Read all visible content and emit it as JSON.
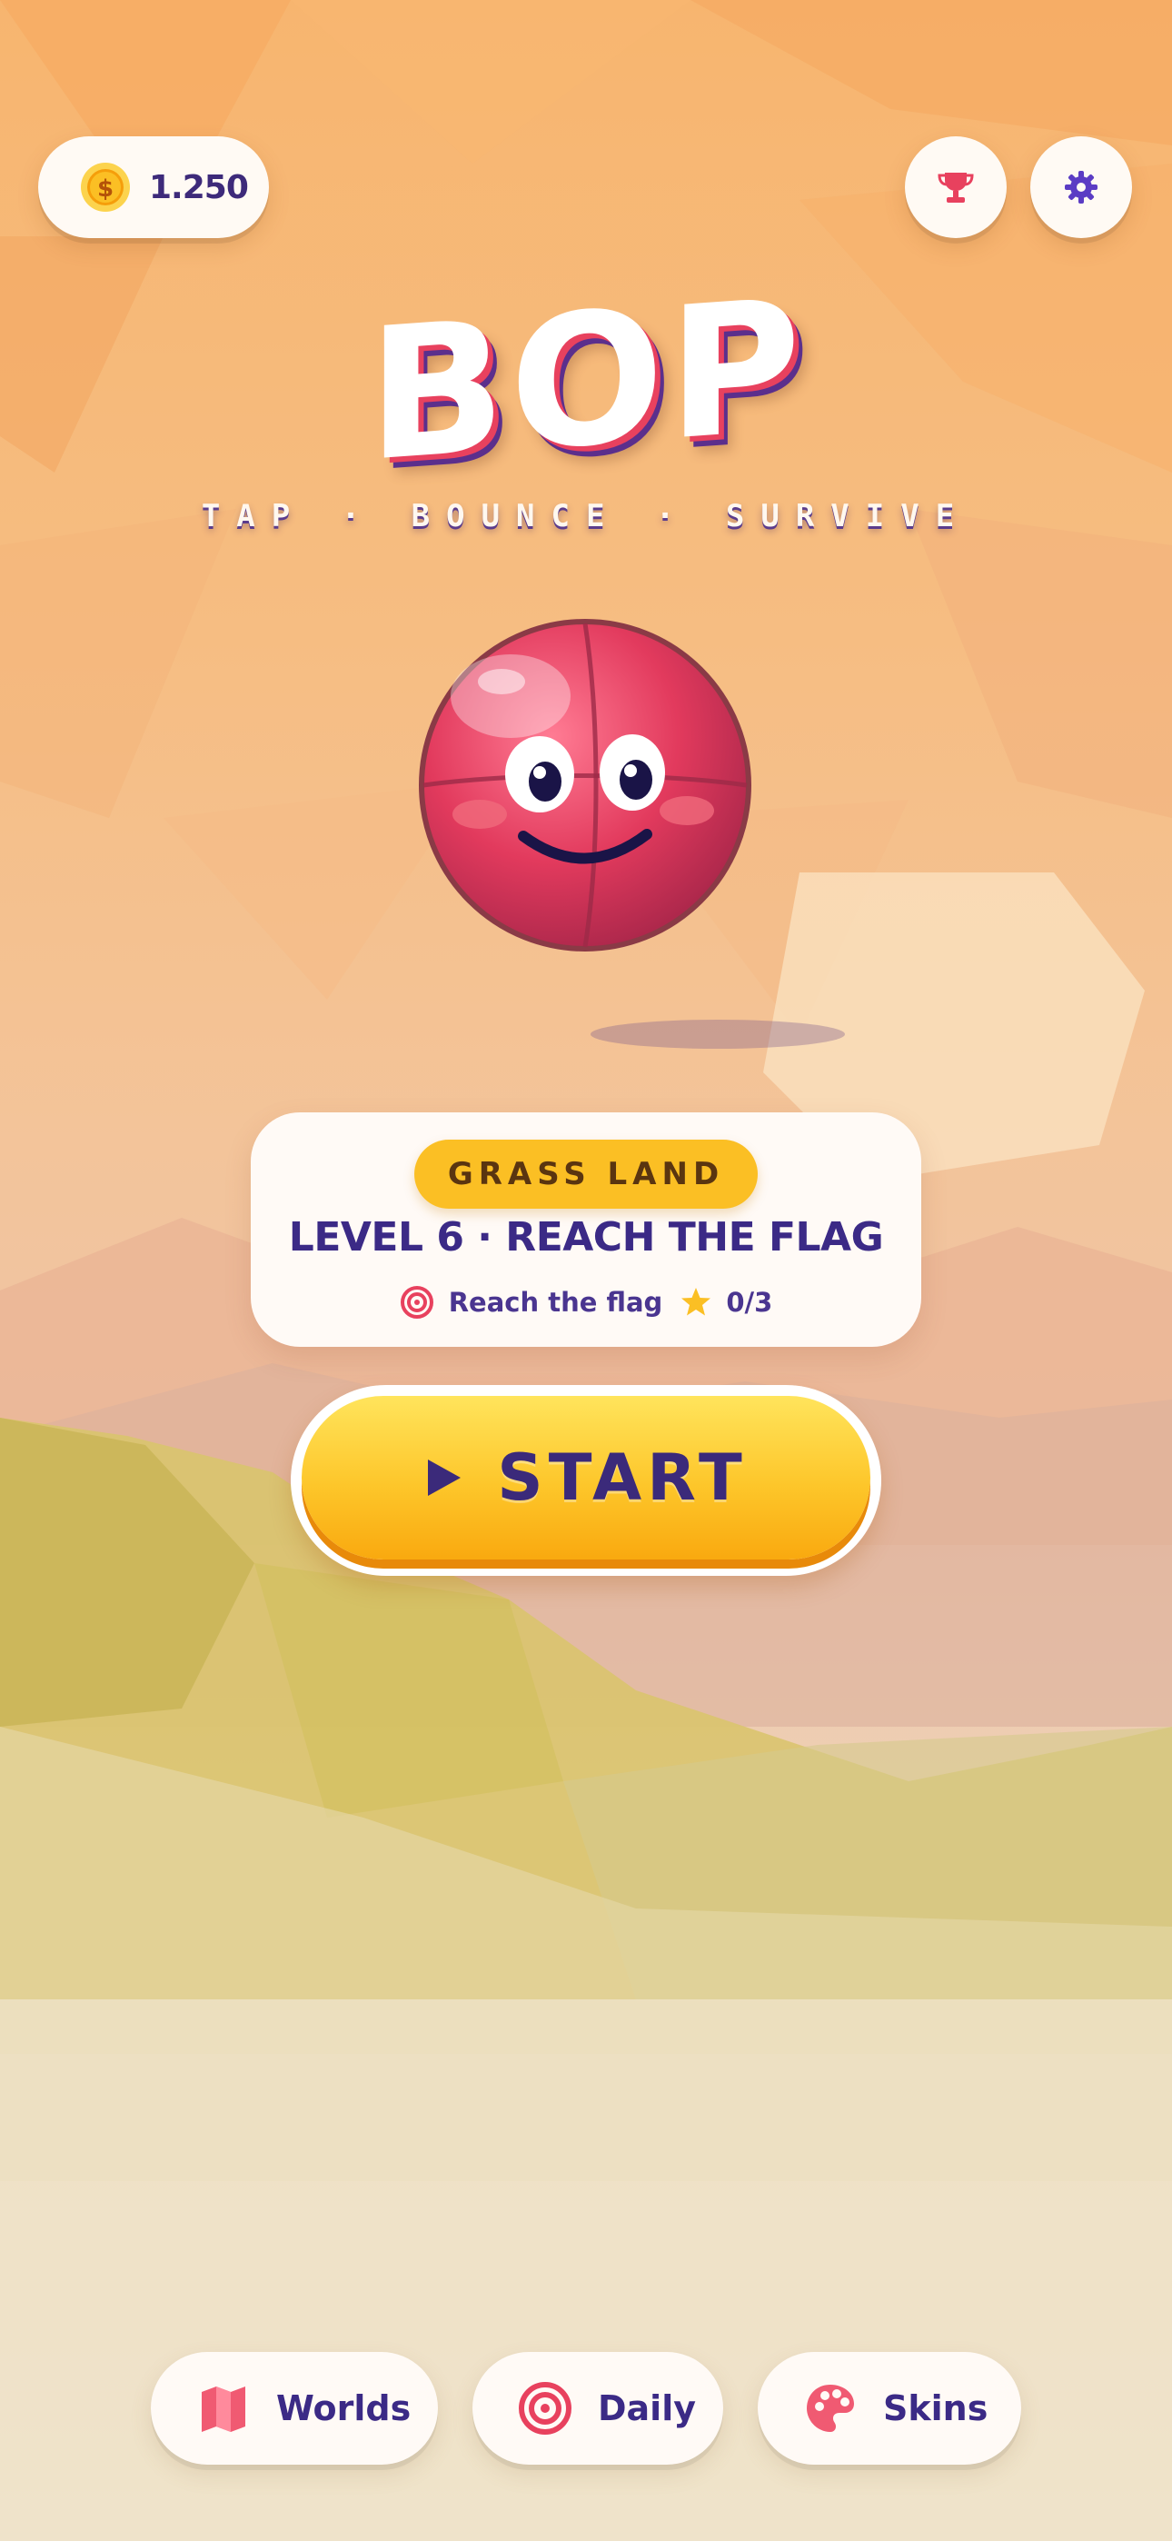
{
  "header": {
    "coins": "1.250",
    "coin_icon": "coin-icon",
    "trophy_icon": "trophy-icon",
    "settings_icon": "gear-icon"
  },
  "title": {
    "game_name": "BOP",
    "tagline": "TAP · BOUNCE · SURVIVE"
  },
  "level_card": {
    "world": "GRASS LAND",
    "level_title": "LEVEL 6 · REACH THE FLAG",
    "objective": "Reach the flag",
    "stars": "0/3"
  },
  "start_button": {
    "label": "START"
  },
  "bottom_nav": {
    "items": [
      {
        "label": "Worlds",
        "icon": "map-icon"
      },
      {
        "label": "Daily",
        "icon": "target-icon"
      },
      {
        "label": "Skins",
        "icon": "palette-icon"
      }
    ]
  },
  "colors": {
    "accent_pink": "#e8415e",
    "accent_purple": "#3b2a86",
    "accent_yellow": "#fbbf24"
  }
}
